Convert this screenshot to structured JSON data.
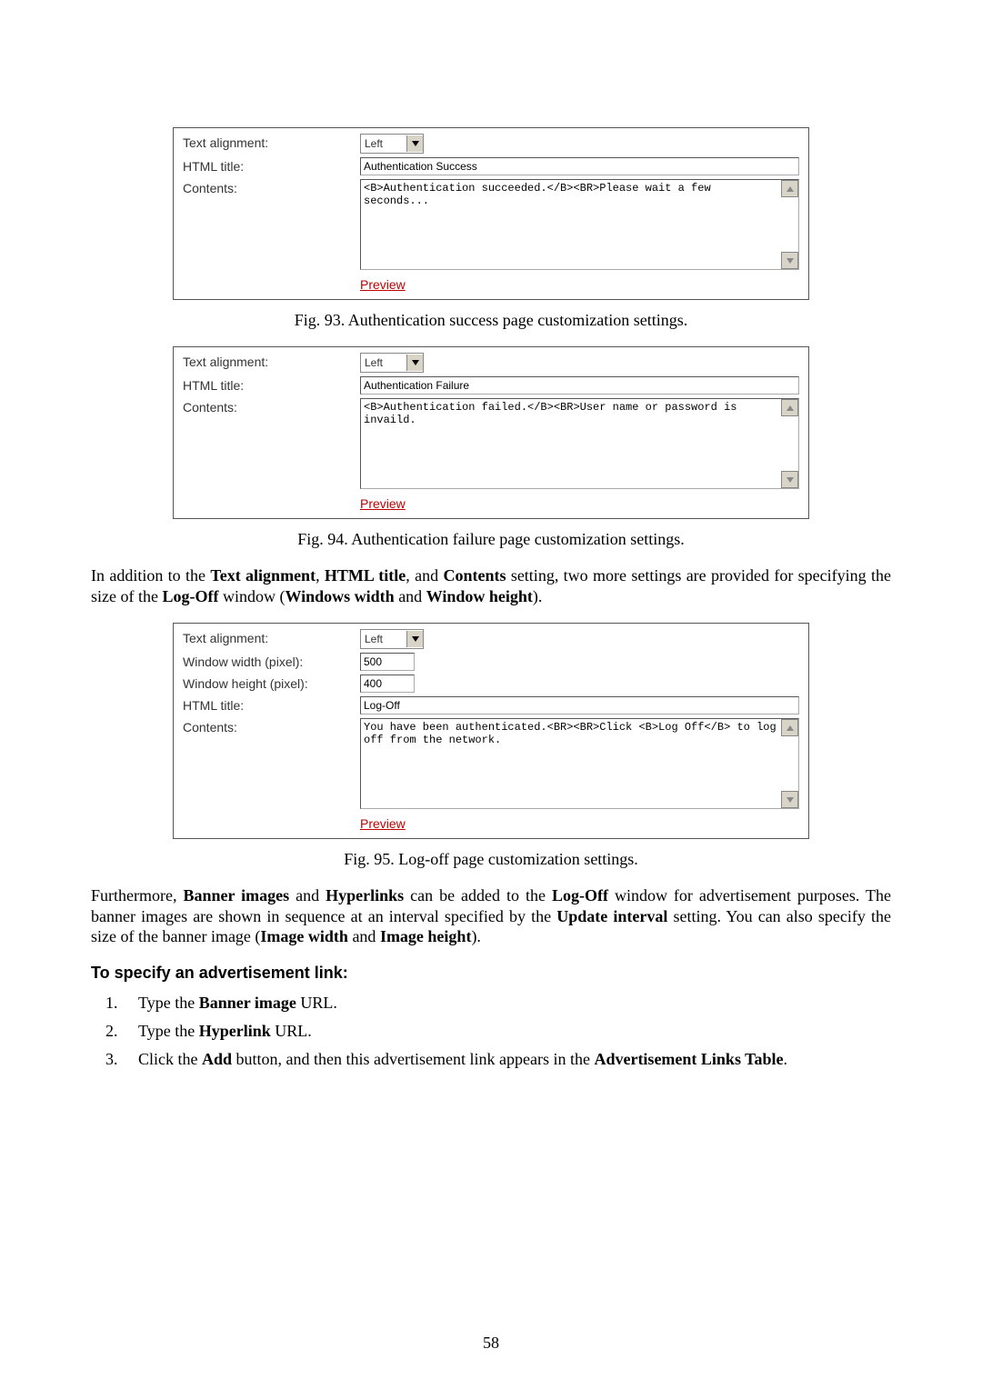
{
  "fig93": {
    "text_align_label": "Text alignment:",
    "text_align_value": "Left",
    "title_label": "HTML title:",
    "title_value": "Authentication Success",
    "contents_label": "Contents:",
    "contents_value": "<B>Authentication succeeded.</B><BR>Please wait a few seconds...",
    "preview": "Preview",
    "caption": "Fig. 93. Authentication success page customization settings."
  },
  "fig94": {
    "text_align_label": "Text alignment:",
    "text_align_value": "Left",
    "title_label": "HTML title:",
    "title_value": "Authentication Failure",
    "contents_label": "Contents:",
    "contents_value": "<B>Authentication failed.</B><BR>User name or password is invaild.",
    "preview": "Preview",
    "caption": "Fig. 94. Authentication failure page customization settings."
  },
  "paragraph1_parts": {
    "p1": "In addition to the ",
    "b1": "Text alignment",
    "p2": ", ",
    "b2": "HTML title",
    "p3": ", and ",
    "b3": "Contents",
    "p4": " setting, two more settings are provided for specifying the size of the ",
    "b4": "Log-Off",
    "p5": " window (",
    "b5": "Windows width",
    "p6": " and ",
    "b6": "Window height",
    "p7": ")."
  },
  "fig95": {
    "text_align_label": "Text alignment:",
    "text_align_value": "Left",
    "ww_label": "Window width (pixel):",
    "ww_value": "500",
    "wh_label": "Window height (pixel):",
    "wh_value": "400",
    "title_label": "HTML title:",
    "title_value": "Log-Off",
    "contents_label": "Contents:",
    "contents_value": "You have been authenticated.<BR><BR>Click <B>Log Off</B> to log off from the network.",
    "preview": "Preview",
    "caption": "Fig. 95. Log-off page customization settings."
  },
  "paragraph2_parts": {
    "p1": "Furthermore, ",
    "b1": "Banner images",
    "p2": " and ",
    "b2": "Hyperlinks",
    "p3": " can be added to the ",
    "b3": "Log-Off",
    "p4": " window for advertisement purposes. The banner images are shown in sequence at an interval specified by the ",
    "b4": "Update interval",
    "p5": " setting. You can also specify the size of the banner image (",
    "b5": "Image width",
    "p6": " and ",
    "b6": "Image height",
    "p7": ")."
  },
  "heading": "To specify an advertisement link:",
  "steps": {
    "s1a": "Type the ",
    "s1b": "Banner image",
    "s1c": " URL.",
    "s2a": "Type the ",
    "s2b": "Hyperlink",
    "s2c": " URL.",
    "s3a": "Click the ",
    "s3b": "Add",
    "s3c": " button, and then this advertisement link appears in the ",
    "s3d": "Advertisement Links Table",
    "s3e": "."
  },
  "page_number": "58"
}
